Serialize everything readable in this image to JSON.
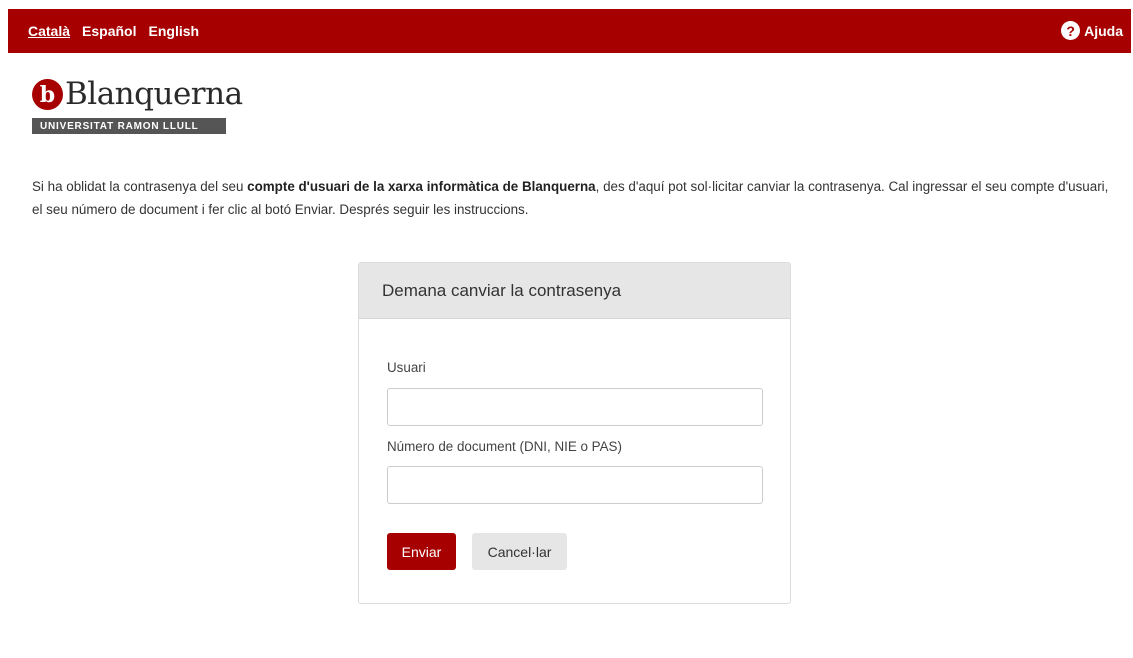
{
  "languages": [
    {
      "label": "Català",
      "active": true
    },
    {
      "label": "Español",
      "active": false
    },
    {
      "label": "English",
      "active": false
    }
  ],
  "help": {
    "icon": "question-circle-icon",
    "label": "Ajuda"
  },
  "brand": {
    "mark": "b",
    "name": "Blanquerna",
    "subtitle": "UNIVERSITAT RAMON LLULL",
    "color": "#a60000"
  },
  "intro": {
    "text_before": "Si ha oblidat la contrasenya del seu ",
    "bold": "compte d'usuari de la xarxa informàtica de Blanquerna",
    "text_after": ", des d'aquí pot sol·licitar canviar la contrasenya. Cal ingressar el seu compte d'usuari, el seu número de document i fer clic al botó Enviar. Després seguir les instruccions."
  },
  "form": {
    "title": "Demana canviar la contrasenya",
    "user_label": "Usuari",
    "user_value": "",
    "document_label": "Número de document (DNI, NIE o PAS)",
    "document_value": "",
    "submit_label": "Enviar",
    "cancel_label": "Cancel·lar"
  }
}
